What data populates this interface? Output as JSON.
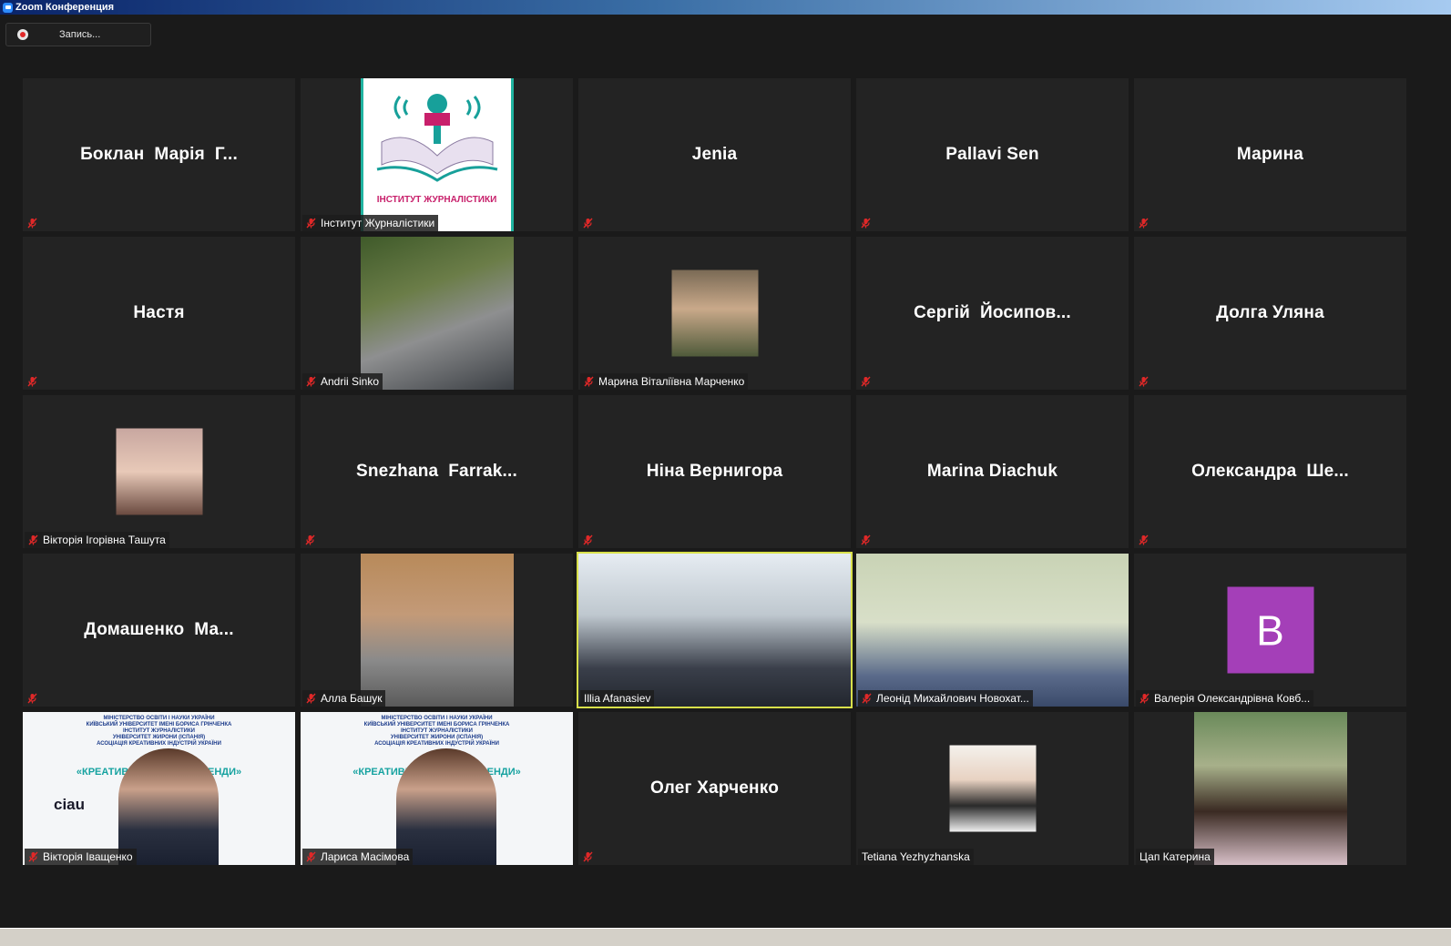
{
  "window": {
    "title": "Zoom Конференция"
  },
  "toolbar": {
    "record_label": "Запись..."
  },
  "colors": {
    "active_speaker": "#d8e04a",
    "avatar_bg": "#a43fb8",
    "muted": "#e02828"
  },
  "tiles": [
    {
      "big": "Боклан  Марія  Г...",
      "tag": "",
      "muted": true
    },
    {
      "big": "",
      "tag": "Інститут Журналістики",
      "muted": true,
      "media": "logo",
      "logo_text": "ІНСТИТУТ ЖУРНАЛІСТИКИ"
    },
    {
      "big": "Jenia",
      "tag": "",
      "muted": true
    },
    {
      "big": "Pallavi Sen",
      "tag": "",
      "muted": true
    },
    {
      "big": "Марина",
      "tag": "",
      "muted": true
    },
    {
      "big": "Настя",
      "tag": "",
      "muted": true
    },
    {
      "big": "",
      "tag": "Andrii Sinko",
      "muted": true,
      "media": "photo"
    },
    {
      "big": "",
      "tag": "Марина Віталіївна Марченко",
      "muted": true,
      "media": "photo-small"
    },
    {
      "big": "Сергій  Йосипов...",
      "tag": "",
      "muted": true
    },
    {
      "big": "Долга Уляна",
      "tag": "",
      "muted": true
    },
    {
      "big": "",
      "tag": "Вікторія Ігорівна Ташута",
      "muted": true,
      "media": "photo-small"
    },
    {
      "big": "Snezhana  Farrak...",
      "tag": "",
      "muted": true
    },
    {
      "big": "Ніна Вернигора",
      "tag": "",
      "muted": true
    },
    {
      "big": "Marina Diachuk",
      "tag": "",
      "muted": true
    },
    {
      "big": "Олександра  Ше...",
      "tag": "",
      "muted": true
    },
    {
      "big": "Домашенко  Ма...",
      "tag": "",
      "muted": true
    },
    {
      "big": "",
      "tag": "Алла Башук",
      "muted": true,
      "media": "photo"
    },
    {
      "big": "",
      "tag": "Illia Afanasiev",
      "muted": false,
      "media": "video-wide",
      "active": true
    },
    {
      "big": "",
      "tag": "Леонід Михайлович Новохат...",
      "muted": true,
      "media": "video-wide"
    },
    {
      "big": "",
      "tag": "Валерія Олександрівна Ковб...",
      "muted": true,
      "media": "avatar",
      "avatar_letter": "B"
    },
    {
      "big": "",
      "tag": "Вікторія Іващенко",
      "muted": true,
      "media": "slide"
    },
    {
      "big": "",
      "tag": "Лариса Масімова",
      "muted": true,
      "media": "slide"
    },
    {
      "big": "Олег Харченко",
      "tag": "",
      "muted": true
    },
    {
      "big": "",
      "tag": "Tetiana Yezhyzhanska",
      "muted": false,
      "media": "photo-small"
    },
    {
      "big": "",
      "tag": "Цап Катерина",
      "muted": false,
      "media": "photo"
    }
  ],
  "slide": {
    "lines": [
      "МІНІСТЕРСТВО ОСВІТИ І НАУКИ УКРАЇНИ",
      "КИЇВСЬКИЙ УНІВЕРСИТЕТ ІМЕНІ БОРИСА ГРІНЧЕНКА",
      "ІНСТИТУТ ЖУРНАЛІСТИКИ",
      "УНІВЕРСИТЕТ ЖИРОНИ (ІСПАНІЯ)",
      "АСОЦІАЦІЯ КРЕАТИВНИХ ІНДУСТРІЙ УКРАЇНИ"
    ],
    "headline": "«КРЕАТИВНІ ІНДУ       АСНІ ТРЕНДИ»",
    "headline2": "«КРЕАТИВН        ІЇ: СУЧАСНІ ТРЕНДИ»",
    "logo_ciau": "ciau"
  }
}
